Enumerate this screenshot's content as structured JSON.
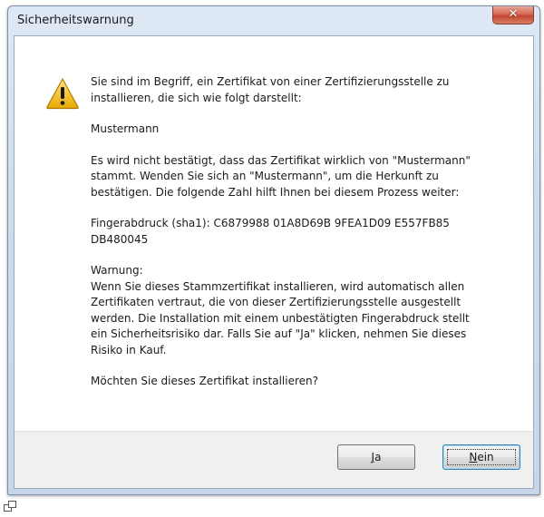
{
  "window": {
    "title": "Sicherheitswarnung",
    "close_glyph": "✕"
  },
  "message": {
    "icon": "warning-icon",
    "paragraphs": [
      "Sie sind im Begriff, ein Zertifikat von einer Zertifizierungsstelle zu\ninstallieren, die sich wie folgt darstellt:",
      "Mustermann",
      "Es wird nicht bestätigt, dass das Zertifikat wirklich von \"Mustermann\"\nstammt. Wenden Sie sich an \"Mustermann\", um die Herkunft zu\nbestätigen. Die folgende Zahl hilft Ihnen bei diesem Prozess weiter:",
      "Fingerabdruck (sha1): C6879988 01A8D69B 9FEA1D09 E557FB85\nDB480045",
      "Warnung:\nWenn Sie dieses Stammzertifikat installieren, wird automatisch allen\nZertifikaten vertraut, die von dieser Zertifizierungsstelle ausgestellt\nwerden. Die Installation mit einem unbestätigten Fingerabdruck stellt\nein Sicherheitsrisiko dar. Falls Sie auf \"Ja\" klicken, nehmen Sie dieses\nRisiko in Kauf.",
      "Möchten Sie dieses Zertifikat installieren?"
    ]
  },
  "buttons": {
    "yes_mnemonic": "J",
    "yes_rest": "a",
    "no_mnemonic": "N",
    "no_rest": "ein"
  },
  "colors": {
    "warning_yellow": "#f5c518",
    "close_red": "#c2452e"
  }
}
